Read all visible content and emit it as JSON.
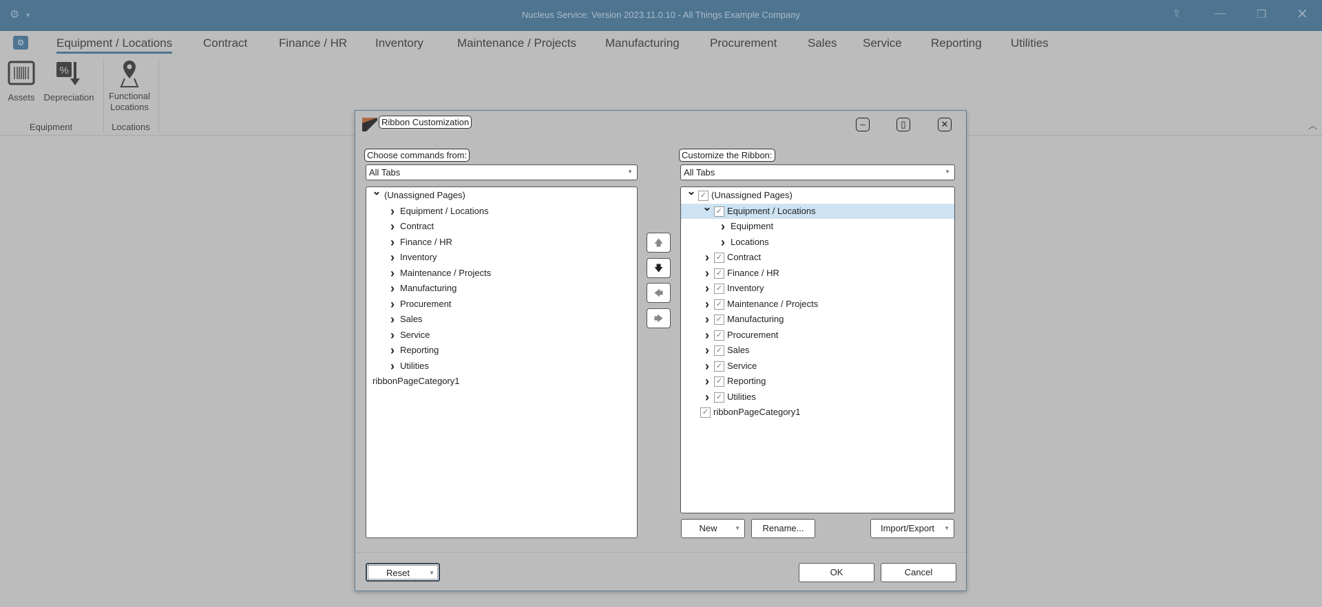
{
  "app": {
    "title": "Nucleus Service: Version 2023.11.0.10 - All Things Example Company"
  },
  "tabs": [
    "Equipment / Locations",
    "Contract",
    "Finance / HR",
    "Inventory",
    "Maintenance / Projects",
    "Manufacturing",
    "Procurement",
    "Sales",
    "Service",
    "Reporting",
    "Utilities"
  ],
  "ribbon": {
    "assets": "Assets",
    "depreciation": "Depreciation",
    "functional_locations": "Functional Locations",
    "group_equipment": "Equipment",
    "group_locations": "Locations"
  },
  "dialog": {
    "title": "Ribbon Customization",
    "left_label": "Choose commands from:",
    "left_combo": "All Tabs",
    "right_label": "Customize the Ribbon:",
    "right_combo": "All Tabs",
    "left_tree": [
      {
        "label": "(Unassigned Pages)",
        "level": 0,
        "chev": "down"
      },
      {
        "label": "Equipment / Locations",
        "level": 1,
        "chev": "right"
      },
      {
        "label": "Contract",
        "level": 1,
        "chev": "right"
      },
      {
        "label": "Finance / HR",
        "level": 1,
        "chev": "right"
      },
      {
        "label": "Inventory",
        "level": 1,
        "chev": "right"
      },
      {
        "label": "Maintenance / Projects",
        "level": 1,
        "chev": "right"
      },
      {
        "label": "Manufacturing",
        "level": 1,
        "chev": "right"
      },
      {
        "label": "Procurement",
        "level": 1,
        "chev": "right"
      },
      {
        "label": "Sales",
        "level": 1,
        "chev": "right"
      },
      {
        "label": "Service",
        "level": 1,
        "chev": "right"
      },
      {
        "label": "Reporting",
        "level": 1,
        "chev": "right"
      },
      {
        "label": "Utilities",
        "level": 1,
        "chev": "right"
      },
      {
        "label": "ribbonPageCategory1",
        "level": 0,
        "chev": "none"
      }
    ],
    "right_tree": [
      {
        "label": "(Unassigned Pages)",
        "level": 0,
        "chev": "down",
        "checked": true
      },
      {
        "label": "Equipment / Locations",
        "level": 1,
        "chev": "down",
        "checked": true,
        "selected": true
      },
      {
        "label": "Equipment",
        "level": 2,
        "chev": "right"
      },
      {
        "label": "Locations",
        "level": 2,
        "chev": "right"
      },
      {
        "label": "Contract",
        "level": 1,
        "chev": "right",
        "checked": true
      },
      {
        "label": "Finance / HR",
        "level": 1,
        "chev": "right",
        "checked": true
      },
      {
        "label": "Inventory",
        "level": 1,
        "chev": "right",
        "checked": true
      },
      {
        "label": "Maintenance / Projects",
        "level": 1,
        "chev": "right",
        "checked": true
      },
      {
        "label": "Manufacturing",
        "level": 1,
        "chev": "right",
        "checked": true
      },
      {
        "label": "Procurement",
        "level": 1,
        "chev": "right",
        "checked": true
      },
      {
        "label": "Sales",
        "level": 1,
        "chev": "right",
        "checked": true
      },
      {
        "label": "Service",
        "level": 1,
        "chev": "right",
        "checked": true
      },
      {
        "label": "Reporting",
        "level": 1,
        "chev": "right",
        "checked": true
      },
      {
        "label": "Utilities",
        "level": 1,
        "chev": "right",
        "checked": true
      },
      {
        "label": "ribbonPageCategory1",
        "level": 0,
        "chev": "none",
        "checked": true
      }
    ],
    "new": "New",
    "rename": "Rename...",
    "import_export": "Import/Export",
    "reset": "Reset",
    "ok": "OK",
    "cancel": "Cancel"
  }
}
